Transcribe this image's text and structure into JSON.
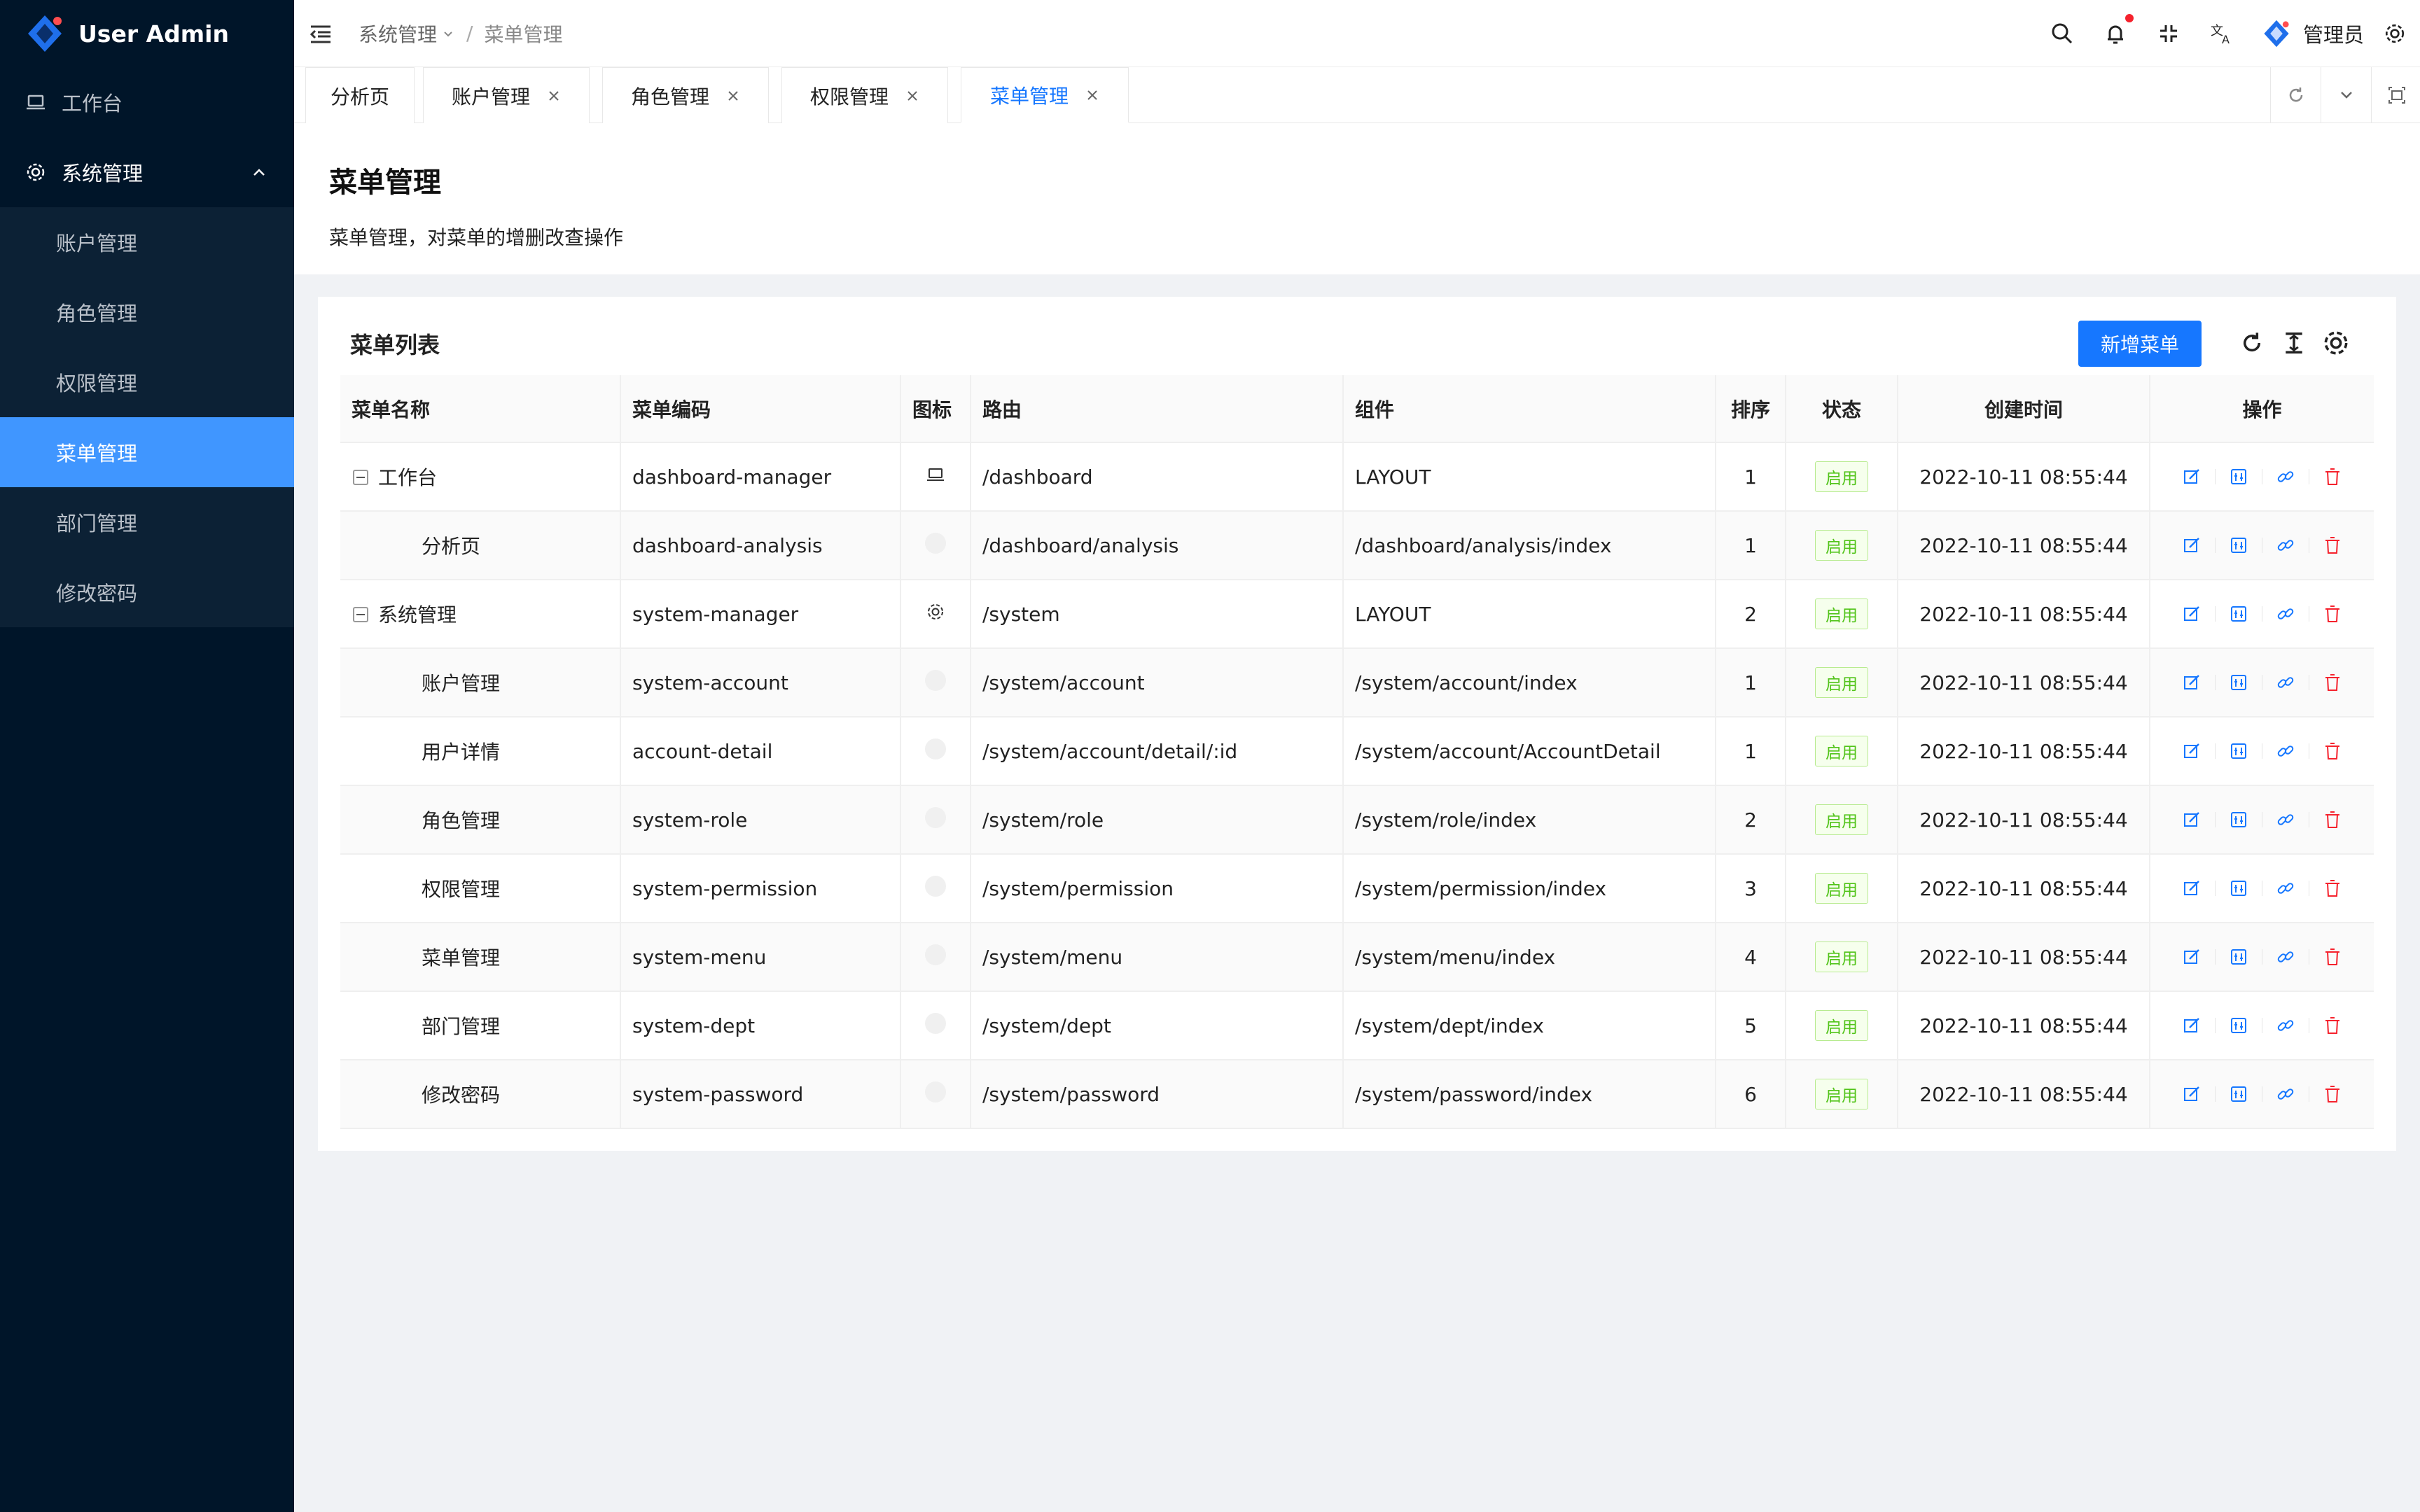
{
  "app": {
    "name": "User Admin"
  },
  "sidebar": {
    "items": [
      {
        "label": "工作台"
      },
      {
        "label": "系统管理"
      }
    ],
    "submenu": [
      {
        "label": "账户管理"
      },
      {
        "label": "角色管理"
      },
      {
        "label": "权限管理"
      },
      {
        "label": "菜单管理",
        "active": true
      },
      {
        "label": "部门管理"
      },
      {
        "label": "修改密码"
      }
    ]
  },
  "header": {
    "breadcrumb": [
      "系统管理",
      "菜单管理"
    ],
    "user_name": "管理员"
  },
  "tabs": [
    {
      "label": "分析页"
    },
    {
      "label": "账户管理"
    },
    {
      "label": "角色管理"
    },
    {
      "label": "权限管理"
    },
    {
      "label": "菜单管理",
      "active": true
    }
  ],
  "page": {
    "title": "菜单管理",
    "description": "菜单管理，对菜单的增删改查操作"
  },
  "card": {
    "title": "菜单列表",
    "add_button": "新增菜单"
  },
  "table": {
    "columns": [
      "菜单名称",
      "菜单编码",
      "图标",
      "路由",
      "组件",
      "排序",
      "状态",
      "创建时间",
      "操作"
    ],
    "rows": [
      {
        "name": "工作台",
        "code": "dashboard-manager",
        "icon": "laptop-icon",
        "route": "/dashboard",
        "component": "LAYOUT",
        "order": "1",
        "status": "启用",
        "created": "2022-10-11 08:55:44"
      },
      {
        "name": "分析页",
        "code": "dashboard-analysis",
        "icon": "",
        "route": "/dashboard/analysis",
        "component": "/dashboard/analysis/index",
        "order": "1",
        "status": "启用",
        "created": "2022-10-11 08:55:44"
      },
      {
        "name": "系统管理",
        "code": "system-manager",
        "icon": "gear-icon",
        "route": "/system",
        "component": "LAYOUT",
        "order": "2",
        "status": "启用",
        "created": "2022-10-11 08:55:44"
      },
      {
        "name": "账户管理",
        "code": "system-account",
        "icon": "",
        "route": "/system/account",
        "component": "/system/account/index",
        "order": "1",
        "status": "启用",
        "created": "2022-10-11 08:55:44"
      },
      {
        "name": "用户详情",
        "code": "account-detail",
        "icon": "",
        "route": "/system/account/detail/:id",
        "component": "/system/account/AccountDetail",
        "order": "1",
        "status": "启用",
        "created": "2022-10-11 08:55:44"
      },
      {
        "name": "角色管理",
        "code": "system-role",
        "icon": "",
        "route": "/system/role",
        "component": "/system/role/index",
        "order": "2",
        "status": "启用",
        "created": "2022-10-11 08:55:44"
      },
      {
        "name": "权限管理",
        "code": "system-permission",
        "icon": "",
        "route": "/system/permission",
        "component": "/system/permission/index",
        "order": "3",
        "status": "启用",
        "created": "2022-10-11 08:55:44"
      },
      {
        "name": "菜单管理",
        "code": "system-menu",
        "icon": "",
        "route": "/system/menu",
        "component": "/system/menu/index",
        "order": "4",
        "status": "启用",
        "created": "2022-10-11 08:55:44"
      },
      {
        "name": "部门管理",
        "code": "system-dept",
        "icon": "",
        "route": "/system/dept",
        "component": "/system/dept/index",
        "order": "5",
        "status": "启用",
        "created": "2022-10-11 08:55:44"
      },
      {
        "name": "修改密码",
        "code": "system-password",
        "icon": "",
        "route": "/system/password",
        "component": "/system/password/index",
        "order": "6",
        "status": "启用",
        "created": "2022-10-11 08:55:44"
      }
    ]
  },
  "colors": {
    "sidebar_bg": "#001529",
    "accent": "#1677ff",
    "active_menu": "#4096ff",
    "success": "#52c41a",
    "danger": "#f5222d"
  }
}
